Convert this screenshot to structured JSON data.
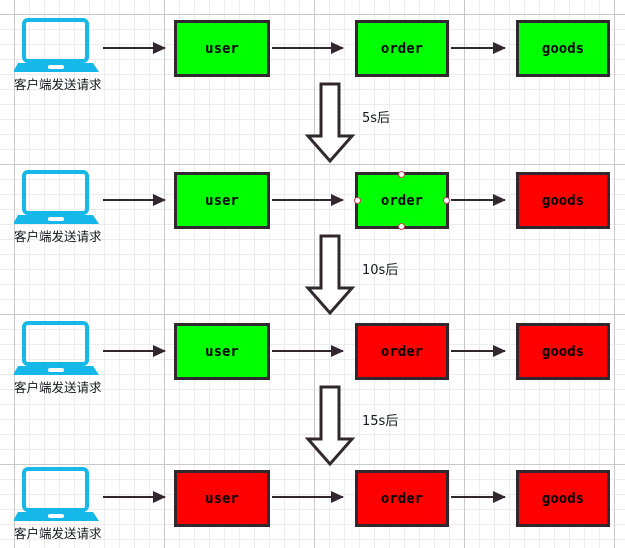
{
  "diagram": {
    "title": "service-degradation-timeline",
    "background": {
      "grid_minor_color": "#ececed",
      "grid_major_color": "#c9c9c9",
      "page_color": "#ffffff"
    },
    "colors": {
      "healthy": "#00ff00",
      "failed": "#fe0000",
      "stroke": "#31282f",
      "laptop": "#15b8e8",
      "handle_border": "#c8405a",
      "text": "#000000"
    },
    "client_caption": "客户端发送请求",
    "client_icon": "laptop-icon",
    "rows": [
      {
        "id": "row-1",
        "nodes": [
          {
            "label": "user",
            "state": "green",
            "selected": false
          },
          {
            "label": "order",
            "state": "green",
            "selected": false
          },
          {
            "label": "goods",
            "state": "green",
            "selected": false
          }
        ]
      },
      {
        "id": "row-2",
        "nodes": [
          {
            "label": "user",
            "state": "green",
            "selected": false
          },
          {
            "label": "order",
            "state": "green",
            "selected": true
          },
          {
            "label": "goods",
            "state": "red",
            "selected": false
          }
        ]
      },
      {
        "id": "row-3",
        "nodes": [
          {
            "label": "user",
            "state": "green",
            "selected": false
          },
          {
            "label": "order",
            "state": "red",
            "selected": false
          },
          {
            "label": "goods",
            "state": "red",
            "selected": false
          }
        ]
      },
      {
        "id": "row-4",
        "nodes": [
          {
            "label": "user",
            "state": "red",
            "selected": false
          },
          {
            "label": "order",
            "state": "red",
            "selected": false
          },
          {
            "label": "goods",
            "state": "red",
            "selected": false
          }
        ]
      }
    ],
    "transitions": [
      {
        "id": "t1",
        "label": "5s后",
        "icon": "down-block-arrow-icon"
      },
      {
        "id": "t2",
        "label": "10s后",
        "icon": "down-block-arrow-icon"
      },
      {
        "id": "t3",
        "label": "15s后",
        "icon": "down-block-arrow-icon"
      }
    ]
  }
}
